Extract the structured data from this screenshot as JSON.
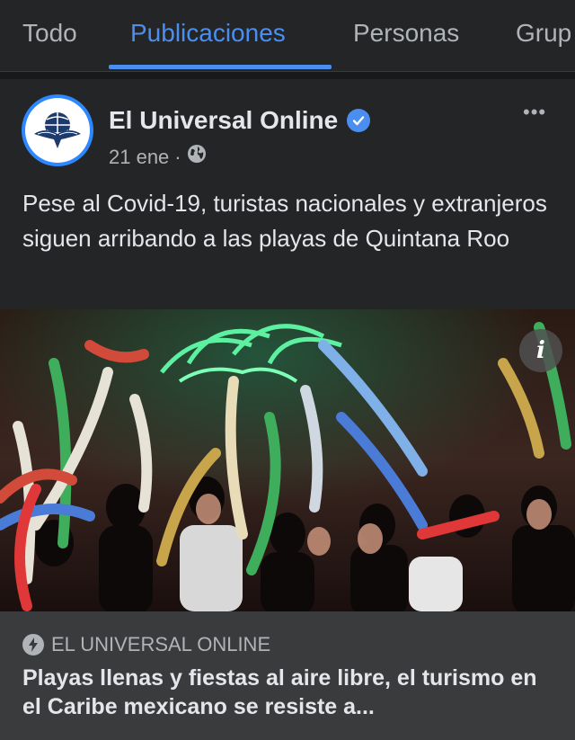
{
  "tabs": [
    {
      "label": "Todo"
    },
    {
      "label": "Publicaciones"
    },
    {
      "label": "Personas"
    },
    {
      "label": "Grup"
    }
  ],
  "post": {
    "author": "El Universal Online",
    "date": "21 ene",
    "separator": "·",
    "audience_icon": "globe-icon",
    "more_label": "•••",
    "text": "Pese al Covid-19, turistas nacionales y extranjeros siguen arribando a las playas de Quintana Roo"
  },
  "photo": {
    "info_label": "i"
  },
  "link": {
    "source": "EL UNIVERSAL ONLINE",
    "headline": "Playas llenas y fiestas al aire libre, el turismo en el Caribe mexicano se resiste a..."
  },
  "colors": {
    "background": "#242526",
    "accent": "#4a8ff0",
    "text_primary": "#e4e6eb",
    "text_secondary": "#b0b3b8",
    "link_box": "#3a3b3c"
  }
}
